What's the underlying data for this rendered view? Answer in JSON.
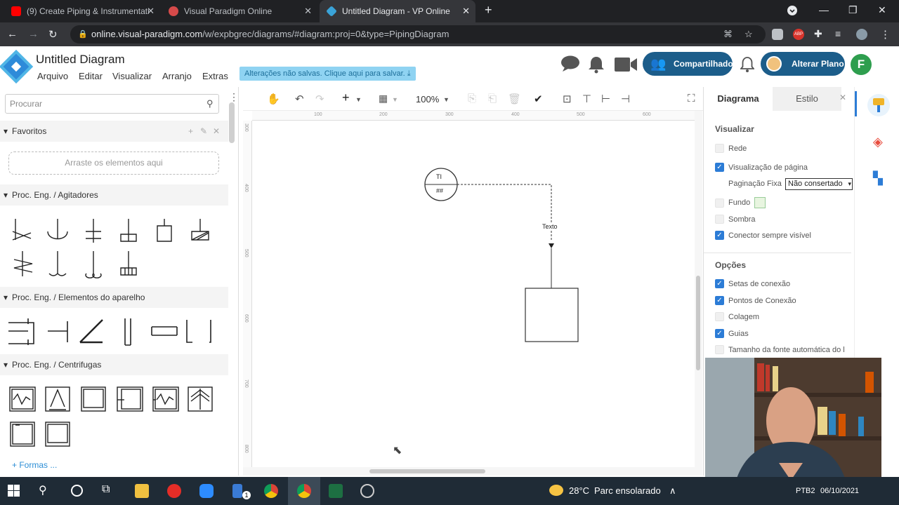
{
  "browser": {
    "tabs": [
      {
        "label": "(9) Create Piping & Instrumentati",
        "color": "#ff0000"
      },
      {
        "label": "Visual Paradigm Online",
        "color": "#d64a4a"
      },
      {
        "label": "Untitled Diagram - VP Online",
        "color": "#3aa3d8"
      }
    ],
    "new_tab": "+",
    "url_host": "online.visual-paradigm.com",
    "url_path": "/w/expbgrec/diagrams/#diagram:proj=0&type=PipingDiagram",
    "ext_abp": "ABP"
  },
  "app": {
    "title": "Untitled Diagram",
    "menus": [
      "Arquivo",
      "Editar",
      "Visualizar",
      "Arranjo",
      "Extras"
    ],
    "unsaved_notice": "Alterações não salvas. Clique aqui para salvar.",
    "share_label": "Compartilhado",
    "plan_label": "Alterar Plano",
    "user_initial": "F"
  },
  "left_panel": {
    "search_placeholder": "Procurar",
    "favorites_label": "Favoritos",
    "dropzone_text": "Arraste os elementos aqui",
    "sections": [
      "Proc. Eng. / Agitadores",
      "Proc. Eng. / Elementos do aparelho",
      "Proc. Eng. / Centrifugas"
    ],
    "more_shapes": "+ Formas ..."
  },
  "toolbar": {
    "zoom": "100%"
  },
  "ruler": {
    "top": [
      "100",
      "200",
      "300",
      "400",
      "500",
      "600"
    ],
    "left": [
      "300",
      "400",
      "500",
      "600",
      "700",
      "800"
    ]
  },
  "diagram": {
    "instrument_top": "TI",
    "instrument_bottom": "##",
    "connector_label": "Texto"
  },
  "right_panel": {
    "tab_diagram": "Diagrama",
    "tab_style": "Estilo",
    "section_view": "Visualizar",
    "view_options": [
      {
        "label": "Rede",
        "checked": false
      },
      {
        "label": "Visualização de página",
        "checked": true
      }
    ],
    "page_fix_label": "Paginação Fixa",
    "page_fix_value": "Não consertado",
    "bg_label": "Fundo",
    "view_options2": [
      {
        "label": "Sombra",
        "checked": false
      },
      {
        "label": "Conector sempre visível",
        "checked": true
      }
    ],
    "section_options": "Opções",
    "options": [
      {
        "label": "Setas de conexão",
        "checked": true
      },
      {
        "label": "Pontos de Conexão",
        "checked": true
      },
      {
        "label": "Colagem",
        "checked": false
      },
      {
        "label": "Guias",
        "checked": true
      },
      {
        "label": "Tamanho da fonte automática do l",
        "checked": false
      }
    ]
  },
  "taskbar": {
    "temperature": "28°C",
    "weather": "Parc ensolarado",
    "lang": "PTB2",
    "date": "06/10/2021",
    "badge": "1"
  }
}
